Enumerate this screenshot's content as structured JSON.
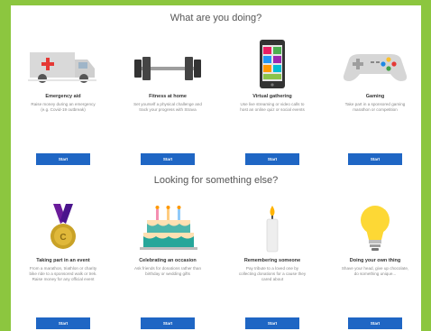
{
  "top_heading": "What are you doing?",
  "mid_heading": "Looking for something else?",
  "row1": [
    {
      "title": "Emergency aid",
      "desc": "Raise money during an emergency (e.g. Covid-19 outbreak)",
      "button": "Start",
      "icon": "ambulance-icon"
    },
    {
      "title": "Fitness at home",
      "desc": "Set yourself a physical challenge and track your progress with Strava",
      "button": "Start",
      "icon": "dumbbell-icon"
    },
    {
      "title": "Virtual gathering",
      "desc": "Use live streaming or video calls to host an online quiz or social events",
      "button": "Start",
      "icon": "phone-icon"
    },
    {
      "title": "Gaming",
      "desc": "Take part in a sponsored gaming marathon or competition",
      "button": "Start",
      "icon": "gamepad-icon"
    }
  ],
  "row2": [
    {
      "title": "Taking part in an event",
      "desc": "From a marathon, triathlon or charity bike ride to a sponsored walk or trek. Raise money for any official event",
      "button": "Start",
      "icon": "medal-icon"
    },
    {
      "title": "Celebrating an occasion",
      "desc": "Ask friends for donations rather than birthday or wedding gifts",
      "button": "Start",
      "icon": "cake-icon"
    },
    {
      "title": "Remembering someone",
      "desc": "Pay tribute to a loved one by collecting donations for a cause they cared about",
      "button": "Start",
      "icon": "candle-icon"
    },
    {
      "title": "Doing your own thing",
      "desc": "Shave your head, give up chocolate, do something unique...",
      "button": "Start",
      "icon": "lightbulb-icon"
    }
  ],
  "colors": {
    "background": "#8cc63f",
    "button": "#1f66c4"
  }
}
